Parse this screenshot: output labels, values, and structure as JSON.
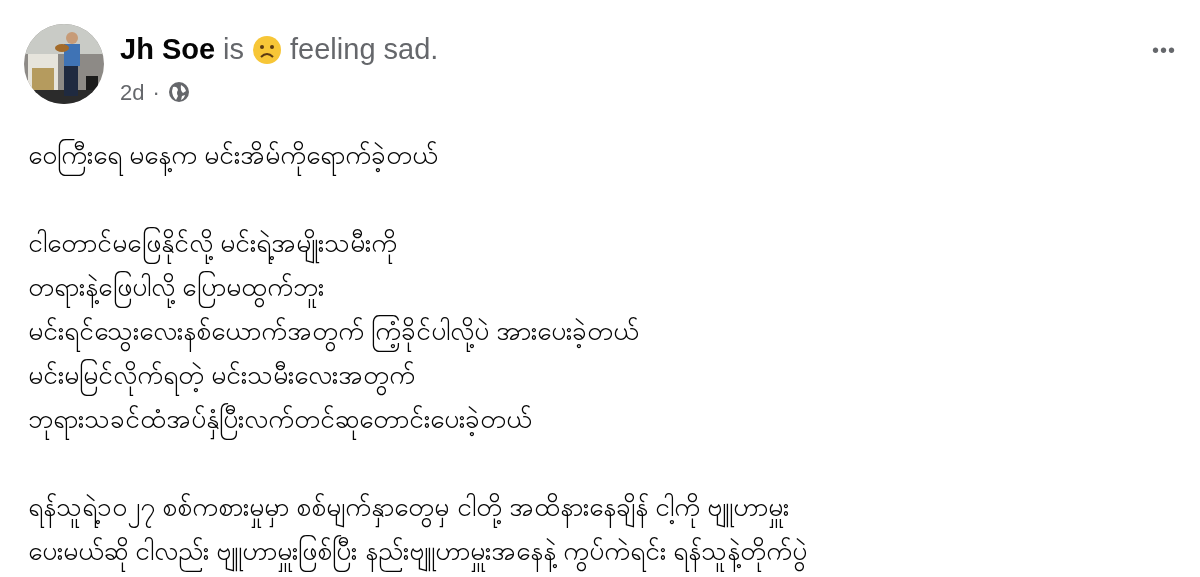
{
  "post": {
    "author": "Jh Soe",
    "verb": "is",
    "feeling": "feeling sad.",
    "time": "2d",
    "separator": "·",
    "menu": "•••",
    "paragraphs": [
      [
        "ဝေကြီးရေ မနေ့က မင်းအိမ်ကိုရောက်ခဲ့တယ်"
      ],
      [
        "ငါတောင်မဖြေနိုင်လို့ မင်းရဲ့အမျိုးသမီးကို",
        "တရားနဲ့ဖြေပါလို့ ပြောမထွက်ဘူး",
        "မင်းရင်သွေးလေးနစ်ယောက်အတွက် ကြံ့ခိုင်ပါလို့ပဲ အားပေးခဲ့တယ်",
        "မင်းမမြင်လိုက်ရတဲ့ မင်းသမီးလေးအတွက်",
        "ဘုရားသခင်ထံအပ်နှံပြီးလက်တင်ဆုတောင်းပေးခဲ့တယ်"
      ],
      [
        "ရန်သူရဲ့၁၀၂၇ စစ်ကစားမှုမှာ စစ်မျက်နှာတွေမှ ငါတို့ အထိနားနေချိန်  ငါ့ကို ဗျူဟာမှူး",
        "ပေးမယ်ဆို ငါလည်း ဗျူဟာမှူးဖြစ်ပြီး နည်းဗျူဟာမှူးအနေနဲ့ ကွပ်ကဲရင်း ရန်သူနဲ့တိုက်ပွဲ"
      ]
    ]
  }
}
